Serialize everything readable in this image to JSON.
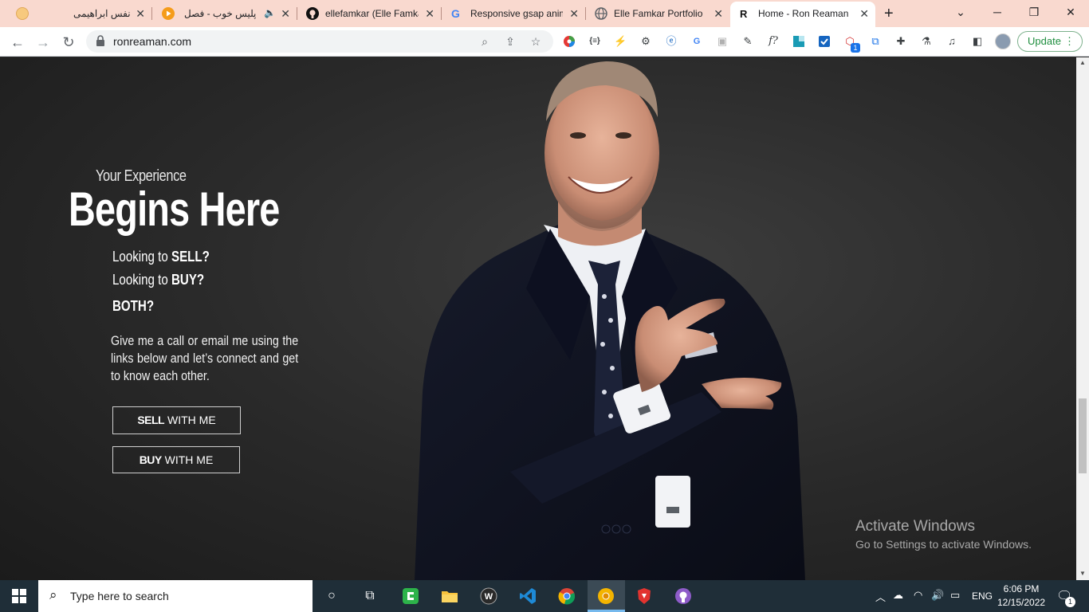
{
  "browser": {
    "tabs": [
      {
        "title": "نفس ابراهیمی",
        "favicon": "orange-circle-icon"
      },
      {
        "title": "پلیس خوب - فصل",
        "favicon": "play-icon",
        "audio": true
      },
      {
        "title": "ellefamkar (Elle Famka",
        "favicon": "github-icon"
      },
      {
        "title": "Responsive gsap anim",
        "favicon": "google-icon"
      },
      {
        "title": "Elle Famkar Portfolio |",
        "favicon": "globe-icon"
      },
      {
        "title": "Home - Ron Reaman |",
        "favicon": "r-icon",
        "active": true
      }
    ],
    "new_tab": "+",
    "url": "ronreaman.com",
    "update_label": "Update"
  },
  "hero": {
    "kicker": "Your Experience",
    "title": "Begins Here",
    "sell_prefix": "Looking to ",
    "sell_word": "SELL?",
    "buy_prefix": "Looking to ",
    "buy_word": "BUY?",
    "both": "BOTH?",
    "blurb": "Give me a call or email me using the links below and let’s connect and get to know each other.",
    "sell_btn_bold": "SELL",
    "sell_btn_rest": " WITH ME",
    "buy_btn_bold": "BUY",
    "buy_btn_rest": " WITH ME"
  },
  "watermark": {
    "line1": "Activate Windows",
    "line2": "Go to Settings to activate Windows."
  },
  "taskbar": {
    "search_placeholder": "Type here to search",
    "language": "ENG",
    "time": "6:06 PM",
    "date": "12/15/2022",
    "notification_count": "1"
  }
}
